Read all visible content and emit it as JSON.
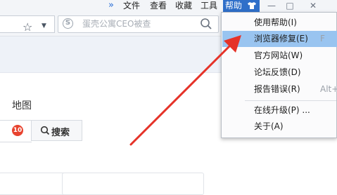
{
  "menubar": {
    "chevron": "»",
    "items": [
      "文件",
      "查看",
      "收藏",
      "工具",
      "帮助"
    ],
    "active_index": 4,
    "controls": {
      "skin": "👕",
      "minimize": "—",
      "maximize": "□",
      "close": "✕"
    }
  },
  "toolbar": {
    "star": "☆",
    "star_dropdown": "▼",
    "search_engine_glyph": "S",
    "search_placeholder": "蛋壳公寓CEO被查"
  },
  "page": {
    "map_link": "地图",
    "badge_count": "10",
    "search_button": "搜索"
  },
  "help_menu": {
    "items": [
      {
        "label": "使用帮助(I)",
        "shortcut": ""
      },
      {
        "label": "浏览器修复(E)",
        "shortcut": "F"
      },
      {
        "label": "官方网站(W)",
        "shortcut": ""
      },
      {
        "label": "论坛反馈(D)",
        "shortcut": ""
      },
      {
        "label": "报告错误(R)",
        "shortcut": "Alt+"
      },
      {
        "label": "在线升级(P) ...",
        "shortcut": ""
      },
      {
        "label": "关于(A)",
        "shortcut": ""
      }
    ],
    "highlighted_index": 1
  },
  "colors": {
    "menu_active": "#2f6fc9",
    "menu_highlight": "#99c4f0",
    "badge": "#e8432f",
    "annotation_arrow": "#e53228"
  }
}
